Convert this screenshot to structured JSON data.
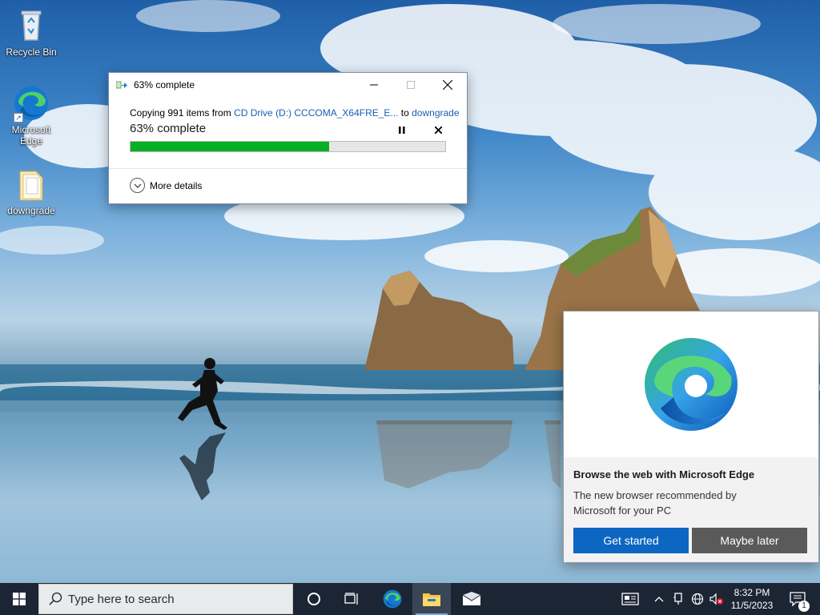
{
  "desktop": {
    "icons": [
      {
        "label": "Recycle Bin",
        "icon": "recycle-bin-icon"
      },
      {
        "label": "Microsoft Edge",
        "icon": "edge-icon"
      },
      {
        "label": "downgrade",
        "icon": "folder-icon"
      }
    ]
  },
  "copy_dialog": {
    "title": "63% complete",
    "copying_prefix": "Copying 991 items from ",
    "source": "CD Drive (D:) CCCOMA_X64FRE_E...",
    "to_word": " to ",
    "destination": "downgrade",
    "status": "63% complete",
    "progress": 0.63,
    "more_details": "More details",
    "accent_color": "#06b025"
  },
  "edge_toast": {
    "title": "Browse the web with Microsoft Edge",
    "text": "The new browser recommended by Microsoft for your PC",
    "primary_button": "Get started",
    "secondary_button": "Maybe later"
  },
  "taskbar": {
    "search_placeholder": "Type here to search",
    "time": "8:32 PM",
    "date": "11/5/2023",
    "notification_count": "1"
  }
}
